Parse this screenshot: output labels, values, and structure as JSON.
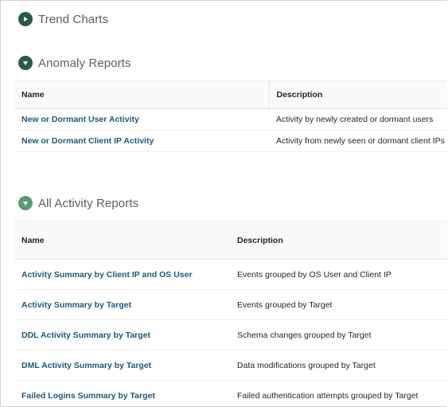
{
  "sections": {
    "trend": {
      "title": "Trend Charts",
      "toggle_icon": "expand-arrow-icon",
      "expanded": false
    },
    "anomaly": {
      "title": "Anomaly Reports",
      "toggle_icon": "collapse-arrow-icon",
      "expanded": true,
      "columns": {
        "name": "Name",
        "description": "Description"
      },
      "rows": [
        {
          "name": "New or Dormant User Activity",
          "description": "Activity by newly created or dormant users"
        },
        {
          "name": "New or Dormant Client IP Activity",
          "description": "Activity from newly seen or dormant client IPs"
        }
      ]
    },
    "all_activity": {
      "title": "All Activity Reports",
      "toggle_icon": "collapse-arrow-icon",
      "expanded": true,
      "columns": {
        "name": "Name",
        "description": "Description"
      },
      "rows": [
        {
          "name": "Activity Summary by Client IP and OS User",
          "description": "Events grouped by OS User and Client IP"
        },
        {
          "name": "Activity Summary by Target",
          "description": "Events grouped by Target"
        },
        {
          "name": "DDL Activity Summary by Target",
          "description": "Schema changes grouped by Target"
        },
        {
          "name": "DML Activity Summary by Target",
          "description": "Data modifications grouped by Target"
        },
        {
          "name": "Failed Logins Summary by Target",
          "description": "Failed authentication attempts grouped by Target"
        }
      ]
    }
  },
  "colors": {
    "toggle_dark": "#2d5a47",
    "toggle_light": "#5c9a74",
    "link": "#1f5778",
    "title": "#5d5d5d"
  }
}
